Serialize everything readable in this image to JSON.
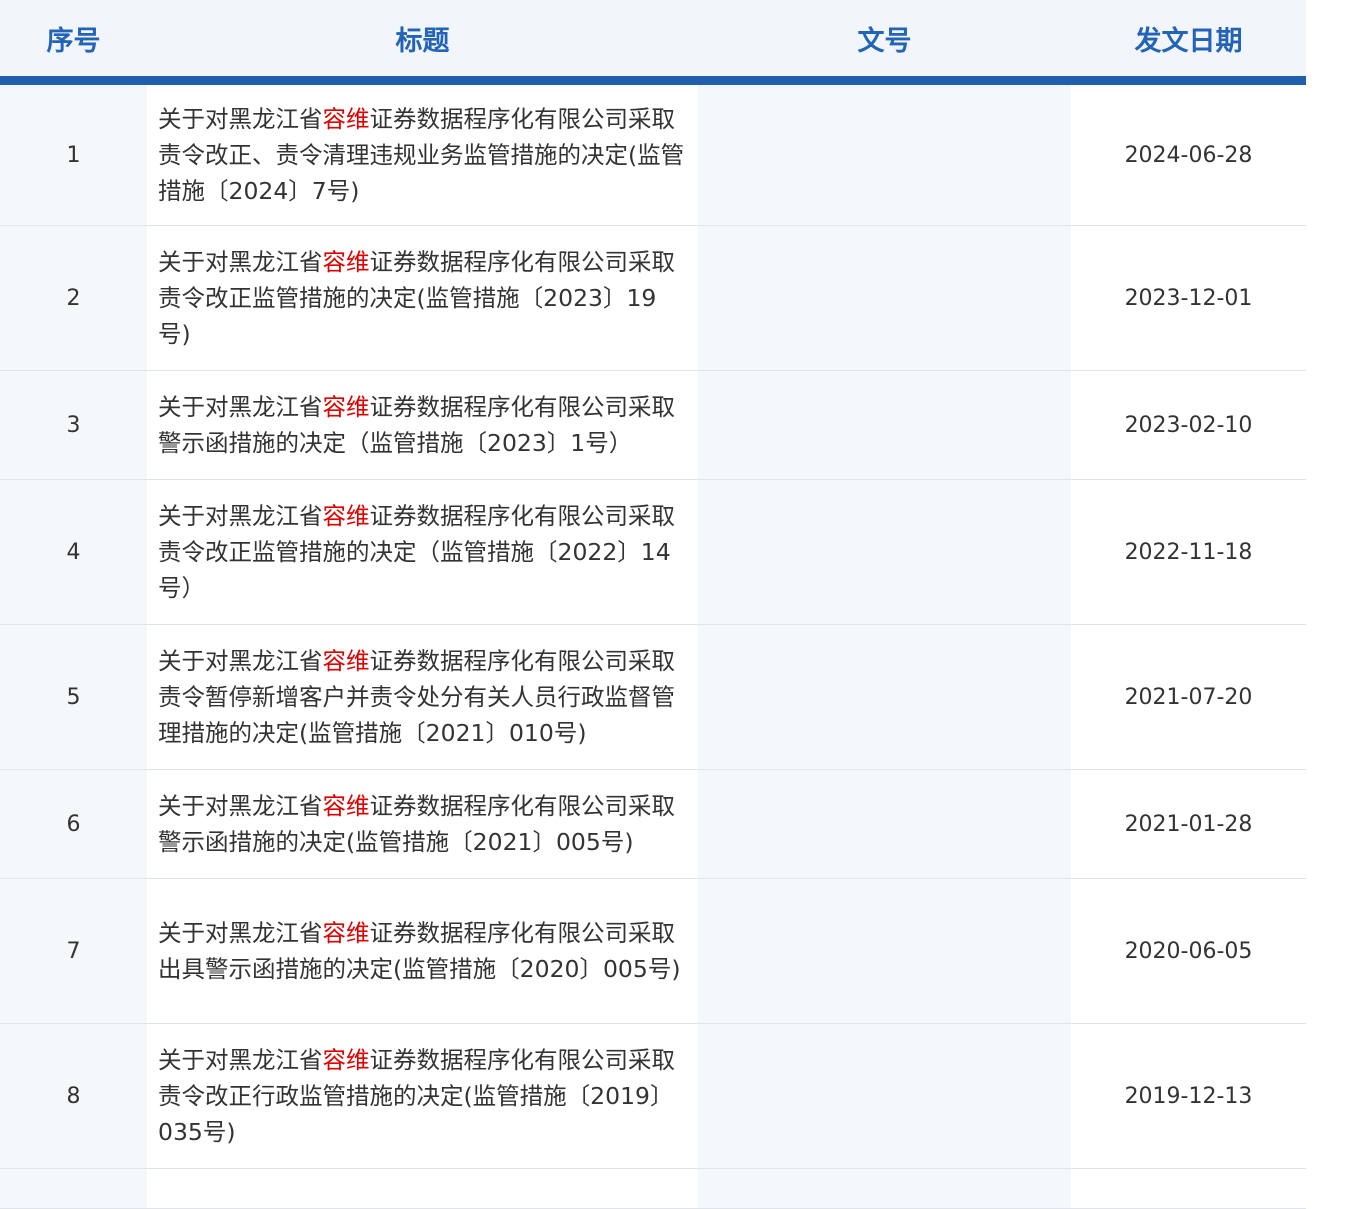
{
  "table": {
    "headers": {
      "index": "序号",
      "title": "标题",
      "doc_no": "文号",
      "date": "发文日期"
    },
    "highlight_color": "#e00000",
    "header_color": "#2364b8",
    "rows": [
      {
        "index": "1",
        "title_prefix": "关于对黑龙江省",
        "title_highlight": "容维",
        "title_suffix": "证券数据程序化有限公司采取责令改正、责令清理违规业务监管措施的决定(监管措施〔2024〕7号)",
        "doc_no": "",
        "date": "2024-06-28"
      },
      {
        "index": "2",
        "title_prefix": "关于对黑龙江省",
        "title_highlight": "容维",
        "title_suffix": "证券数据程序化有限公司采取责令改正监管措施的决定(监管措施〔2023〕19号)",
        "doc_no": "",
        "date": "2023-12-01"
      },
      {
        "index": "3",
        "title_prefix": "关于对黑龙江省",
        "title_highlight": "容维",
        "title_suffix": "证券数据程序化有限公司采取警示函措施的决定（监管措施〔2023〕1号）",
        "doc_no": "",
        "date": "2023-02-10"
      },
      {
        "index": "4",
        "title_prefix": "关于对黑龙江省",
        "title_highlight": "容维",
        "title_suffix": "证券数据程序化有限公司采取责令改正监管措施的决定（监管措施〔2022〕14号）",
        "doc_no": "",
        "date": "2022-11-18"
      },
      {
        "index": "5",
        "title_prefix": "关于对黑龙江省",
        "title_highlight": "容维",
        "title_suffix": "证券数据程序化有限公司采取责令暂停新增客户并责令处分有关人员行政监督管理措施的决定(监管措施〔2021〕010号)",
        "doc_no": "",
        "date": "2021-07-20"
      },
      {
        "index": "6",
        "title_prefix": "关于对黑龙江省",
        "title_highlight": "容维",
        "title_suffix": "证券数据程序化有限公司采取警示函措施的决定(监管措施〔2021〕005号)",
        "doc_no": "",
        "date": "2021-01-28"
      },
      {
        "index": "7",
        "title_prefix": "关于对黑龙江省",
        "title_highlight": "容维",
        "title_suffix": "证券数据程序化有限公司采取出具警示函措施的决定(监管措施〔2020〕005号)",
        "doc_no": "",
        "date": "2020-06-05"
      },
      {
        "index": "8",
        "title_prefix": "关于对黑龙江省",
        "title_highlight": "容维",
        "title_suffix": "证券数据程序化有限公司采取责令改正行政监管措施的决定(监管措施〔2019〕035号)",
        "doc_no": "",
        "date": "2019-12-13"
      }
    ]
  }
}
